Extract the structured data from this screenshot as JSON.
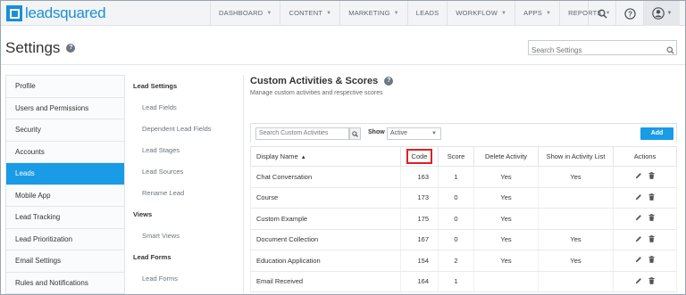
{
  "header": {
    "logo_text": "leadsquared",
    "nav": [
      "DASHBOARD",
      "CONTENT",
      "MARKETING",
      "LEADS",
      "WORKFLOW",
      "APPS",
      "REPORTS"
    ],
    "nav_has_dropdown": [
      true,
      true,
      true,
      false,
      true,
      true,
      true
    ]
  },
  "page": {
    "title": "Settings",
    "search_placeholder": "Search Settings"
  },
  "leftmenu": {
    "items": [
      "Profile",
      "Users and Permissions",
      "Security",
      "Accounts",
      "Leads",
      "Mobile App",
      "Lead Tracking",
      "Lead Prioritization",
      "Email Settings",
      "Rules and Notifications"
    ],
    "active": "Leads"
  },
  "submenu": {
    "sections": [
      {
        "heading": "Lead Settings",
        "items": [
          "Lead Fields",
          "Dependent Lead Fields",
          "Lead Stages",
          "Lead Sources",
          "Rename Lead"
        ]
      },
      {
        "heading": "Views",
        "items": [
          "Smart Views"
        ]
      },
      {
        "heading": "Lead Forms",
        "items": [
          "Lead Forms"
        ]
      }
    ]
  },
  "content": {
    "title": "Custom Activities & Scores",
    "subtitle": "Manage custom activities and respective scores",
    "search_placeholder": "Search Custom Activities",
    "show_label": "Show",
    "show_value": "Active",
    "add_label": "Add",
    "columns": [
      "Display Name",
      "Code",
      "Score",
      "Delete Activity",
      "Show in Activity List",
      "Actions"
    ],
    "rows": [
      {
        "name": "Chat Conversation",
        "code": "163",
        "score": "1",
        "delete": "Yes",
        "show": "Yes"
      },
      {
        "name": "Course",
        "code": "173",
        "score": "0",
        "delete": "Yes",
        "show": ""
      },
      {
        "name": "Custom Example",
        "code": "175",
        "score": "0",
        "delete": "Yes",
        "show": ""
      },
      {
        "name": "Document Collection",
        "code": "167",
        "score": "0",
        "delete": "Yes",
        "show": "Yes"
      },
      {
        "name": "Education Application",
        "code": "154",
        "score": "2",
        "delete": "Yes",
        "show": "Yes"
      },
      {
        "name": "Email Received",
        "code": "164",
        "score": "1",
        "delete": "",
        "show": ""
      }
    ]
  },
  "colors": {
    "accent": "#1a9be6",
    "highlight_box": "#e02020",
    "logo": "#1a8fd6"
  },
  "icons": {
    "search": "search-icon",
    "help": "help-icon",
    "user": "user-icon",
    "edit": "pencil-icon",
    "delete": "trash-icon"
  }
}
